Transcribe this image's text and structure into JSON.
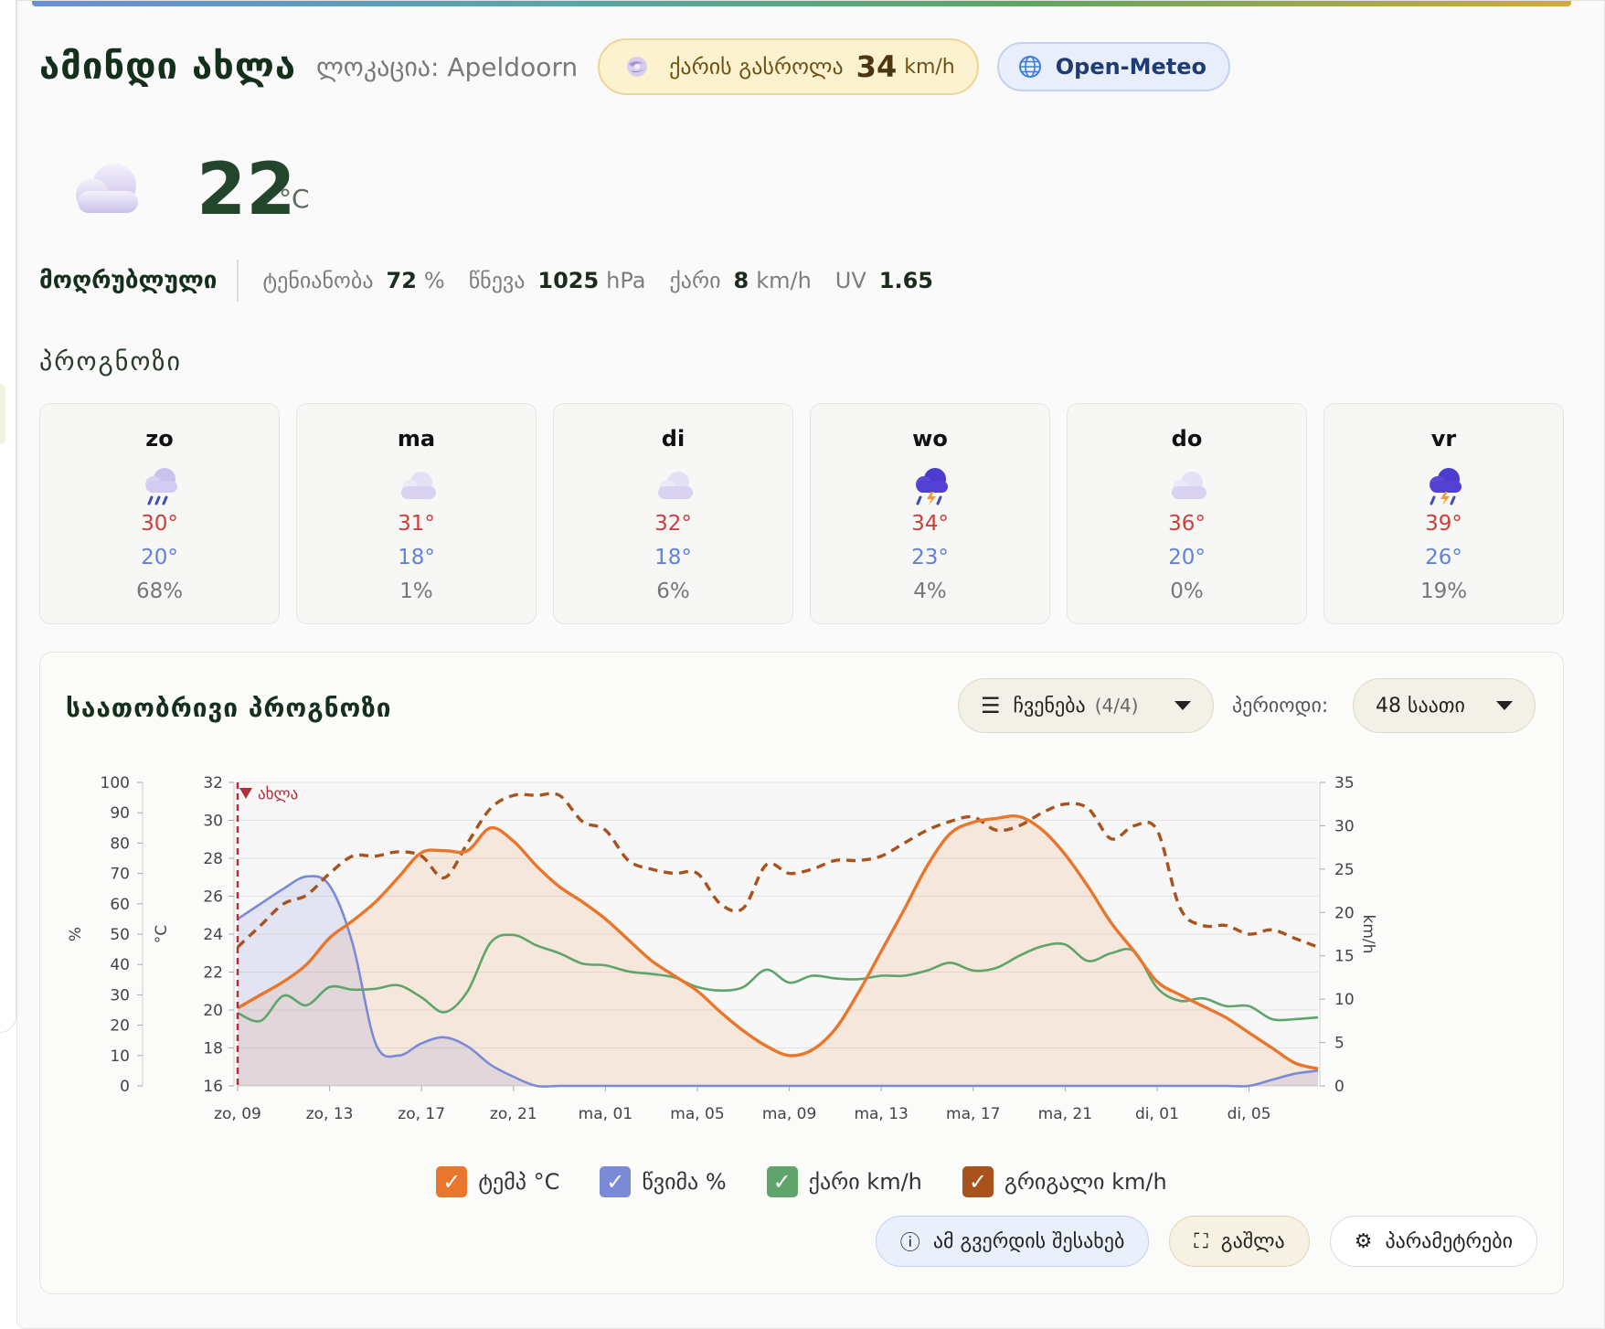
{
  "header": {
    "app_title": "ამინდი ახლა",
    "location": "ლოკაცია: Apeldoorn",
    "gust_label": "ქარის გასროლა",
    "gust_value": "34",
    "gust_unit": "km/h",
    "source_label": "Open-Meteo"
  },
  "current": {
    "temp": "22",
    "unit": "°C",
    "condition": "მოღრუბლული",
    "humidity_label": "ტენიანობა",
    "humidity_value": "72",
    "humidity_unit": "%",
    "pressure_label": "წნევა",
    "pressure_value": "1025",
    "pressure_unit": "hPa",
    "wind_label": "ქარი",
    "wind_value": "8",
    "wind_unit": "km/h",
    "uv_label": "UV",
    "uv_value": "1.65"
  },
  "forecast": {
    "title": "პროგნოზი",
    "days": [
      {
        "day": "zo",
        "icon": "rain-cloud-icon",
        "hi": "30°",
        "lo": "20°",
        "precip": "68%"
      },
      {
        "day": "ma",
        "icon": "cloud-icon",
        "hi": "31°",
        "lo": "18°",
        "precip": "1%"
      },
      {
        "day": "di",
        "icon": "cloud-icon",
        "hi": "32°",
        "lo": "18°",
        "precip": "6%"
      },
      {
        "day": "wo",
        "icon": "thunderstorm-icon",
        "hi": "34°",
        "lo": "23°",
        "precip": "4%"
      },
      {
        "day": "do",
        "icon": "cloud-icon",
        "hi": "36°",
        "lo": "20°",
        "precip": "0%"
      },
      {
        "day": "vr",
        "icon": "thunderstorm-icon",
        "hi": "39°",
        "lo": "26°",
        "precip": "19%"
      }
    ]
  },
  "hourly": {
    "title": "საათობრივი პროგნოზი",
    "show_label": "ჩვენება",
    "show_count": "(4/4)",
    "period_label": "პერიოდი:",
    "period_value": "48 საათი",
    "legend": [
      {
        "label": "ტემპ °C",
        "color": "#e8762c"
      },
      {
        "label": "წვიმა %",
        "color": "#7b8ad6"
      },
      {
        "label": "ქარი km/h",
        "color": "#5fa46a"
      },
      {
        "label": "გრიგალი km/h",
        "color": "#a8521d"
      }
    ],
    "buttons": {
      "about": "ამ გვერდის შესახებ",
      "fullscreen": "გაშლა",
      "settings": "პარამეტრები"
    }
  },
  "chart_data": {
    "type": "line",
    "now_label": "ახლა",
    "x_tick_labels": [
      "zo, 09",
      "zo, 13",
      "zo, 17",
      "zo, 21",
      "ma, 01",
      "ma, 05",
      "ma, 09",
      "ma, 13",
      "ma, 17",
      "ma, 21",
      "di, 01",
      "di, 05"
    ],
    "x_hours": [
      0,
      4,
      8,
      12,
      16,
      20,
      24,
      28,
      32,
      36,
      40,
      44
    ],
    "x_range": [
      0,
      47
    ],
    "axes": {
      "left_percent": {
        "label": "%",
        "range": [
          0,
          100
        ],
        "ticks": [
          0,
          10,
          20,
          30,
          40,
          50,
          60,
          70,
          80,
          90,
          100
        ]
      },
      "left_temp": {
        "label": "°C",
        "range": [
          16,
          32
        ],
        "ticks": [
          16,
          18,
          20,
          22,
          24,
          26,
          28,
          30,
          32
        ]
      },
      "right_speed": {
        "label": "km/h",
        "range": [
          0,
          35
        ],
        "ticks": [
          0,
          5,
          10,
          15,
          20,
          25,
          30,
          35
        ]
      }
    },
    "series": [
      {
        "name": "ტემპ °C",
        "axis": "left_temp",
        "color": "#e8762c",
        "values": [
          20.1,
          20.8,
          21.5,
          22.4,
          23.8,
          24.7,
          25.7,
          27.0,
          28.3,
          28.4,
          28.4,
          29.6,
          28.9,
          27.6,
          26.5,
          25.7,
          24.8,
          23.7,
          22.6,
          21.8,
          21.0,
          19.9,
          18.9,
          18.1,
          17.6,
          17.9,
          19.0,
          20.9,
          23.1,
          25.3,
          27.6,
          29.3,
          29.9,
          30.1,
          30.2,
          29.5,
          28.2,
          26.5,
          24.6,
          23.1,
          21.5,
          20.8,
          20.2,
          19.6,
          18.8,
          18.0,
          17.2,
          16.9
        ]
      },
      {
        "name": "წვიმა %",
        "axis": "left_percent",
        "color": "#7b8ad6",
        "values": [
          55,
          60,
          65,
          69,
          66,
          47,
          14,
          10,
          14,
          16,
          13,
          7,
          3,
          0,
          0,
          0,
          0,
          0,
          0,
          0,
          0,
          0,
          0,
          0,
          0,
          0,
          0,
          0,
          0,
          0,
          0,
          0,
          0,
          0,
          0,
          0,
          0,
          0,
          0,
          0,
          0,
          0,
          0,
          0,
          0,
          2,
          4,
          5
        ]
      },
      {
        "name": "ქარი km/h",
        "axis": "right_speed",
        "color": "#5fa46a",
        "values": [
          8.4,
          7.5,
          10.4,
          9.3,
          11.4,
          11.1,
          11.2,
          11.6,
          10.2,
          8.5,
          10.9,
          16.5,
          17.4,
          16.2,
          15.3,
          14.1,
          13.9,
          13.2,
          12.9,
          12.5,
          11.4,
          11.0,
          11.4,
          13.4,
          11.9,
          12.7,
          12.4,
          12.3,
          12.7,
          12.7,
          13.3,
          14.2,
          13.3,
          13.6,
          15.0,
          16.1,
          16.3,
          14.4,
          15.3,
          15.5,
          11.3,
          9.8,
          10.1,
          9.2,
          9.2,
          7.7,
          7.7,
          7.9
        ]
      },
      {
        "name": "გრიგალი km/h",
        "axis": "right_speed",
        "color": "#a8521d",
        "values": [
          16,
          18.5,
          21,
          22,
          24.5,
          26.5,
          26.5,
          27,
          26.5,
          24,
          28,
          32,
          33.5,
          33.5,
          33.5,
          30.5,
          29.5,
          26,
          25,
          24.5,
          24.5,
          21,
          20.5,
          25.5,
          24.5,
          25,
          26,
          26,
          26.5,
          28,
          29.5,
          30.5,
          31,
          29.5,
          30,
          31.5,
          32.5,
          32,
          28.5,
          30,
          29.5,
          20.5,
          18.5,
          18.5,
          17.5,
          18,
          17,
          16
        ]
      }
    ]
  }
}
